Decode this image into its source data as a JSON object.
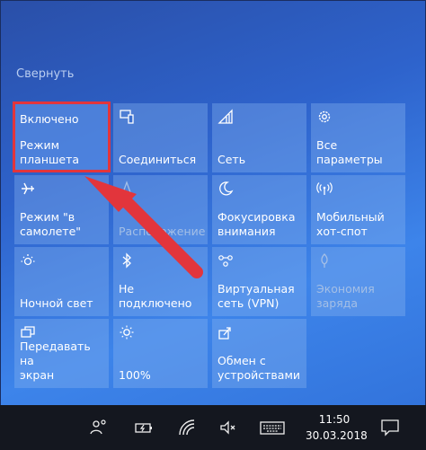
{
  "panel": {
    "collapse_label": "Свернуть"
  },
  "tiles": [
    {
      "id": "tablet",
      "state": "Включено",
      "label": "Режим\nпланшета",
      "icon": "tablet-mode-icon",
      "active": true
    },
    {
      "id": "connect",
      "label": "Соединиться",
      "icon": "connect-icon"
    },
    {
      "id": "network",
      "label": "Сеть",
      "icon": "network-icon"
    },
    {
      "id": "settings",
      "label": "Все параметры",
      "icon": "gear-icon"
    },
    {
      "id": "airplane",
      "label": "Режим \"в\nсамолете\"",
      "icon": "airplane-icon"
    },
    {
      "id": "location",
      "label": "Расположение",
      "icon": "location-icon",
      "dim": true
    },
    {
      "id": "focus",
      "label": "Фокусировка\nвнимания",
      "icon": "moon-icon"
    },
    {
      "id": "hotspot",
      "label": "Мобильный\nхот-спот",
      "icon": "hotspot-icon"
    },
    {
      "id": "nightlight",
      "label": "Ночной свет",
      "icon": "night-light-icon"
    },
    {
      "id": "bluetooth",
      "label": "Не\nподключено",
      "icon": "bluetooth-icon"
    },
    {
      "id": "vpn",
      "label": "Виртуальная\nсеть (VPN)",
      "icon": "vpn-icon"
    },
    {
      "id": "battery",
      "label": "Экономия\nзаряда",
      "icon": "battery-saver-icon",
      "dim": true
    },
    {
      "id": "project",
      "label": "Передавать на\nэкран",
      "icon": "project-icon"
    },
    {
      "id": "brightness",
      "label": "100%",
      "icon": "brightness-icon"
    },
    {
      "id": "share",
      "label": "Обмен с\nустройствами",
      "icon": "nearby-share-icon"
    }
  ],
  "taskbar": {
    "time": "11:50",
    "date": "30.03.2018"
  },
  "colors": {
    "highlight": "#e2353c",
    "arrow": "#e2353c"
  }
}
